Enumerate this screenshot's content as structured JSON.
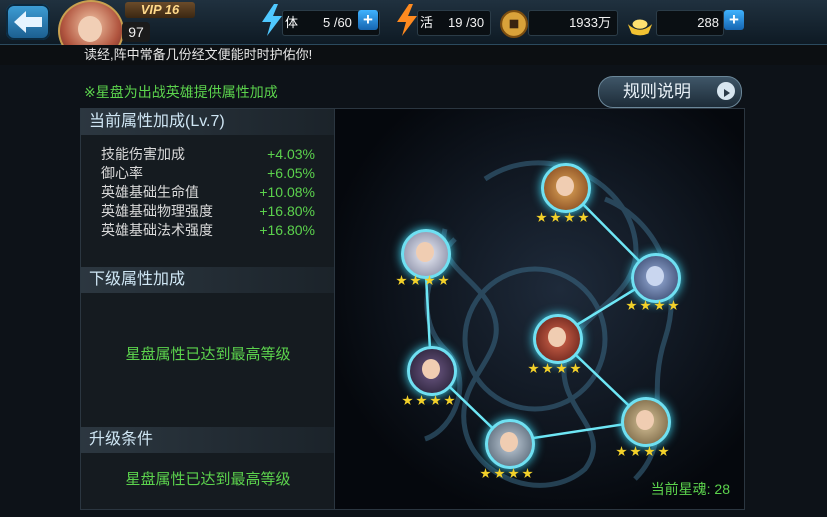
{
  "topbar": {
    "vip": "VIP 16",
    "level": "97",
    "stamina": {
      "label": "体",
      "value": "5 /60"
    },
    "vitality": {
      "label": "活",
      "value": "19 /30"
    },
    "coins": {
      "value": "1933万"
    },
    "gold": {
      "value": "288"
    }
  },
  "ticker": {
    "text": "读经,阵中常备几份经文便能时时护佑你!"
  },
  "note": "※星盘为出战英雄提供属性加成",
  "rules_button": "规则说明",
  "current": {
    "title": "当前属性加成(Lv.7)",
    "attributes": [
      {
        "name": "技能伤害加成",
        "value": "+4.03%"
      },
      {
        "name": "御心率",
        "value": "+6.05%"
      },
      {
        "name": "英雄基础生命值",
        "value": "+10.08%"
      },
      {
        "name": "英雄基础物理强度",
        "value": "+16.80%"
      },
      {
        "name": "英雄基础法术强度",
        "value": "+16.80%"
      }
    ]
  },
  "next": {
    "title": "下级属性加成",
    "message": "星盘属性已达到最高等级"
  },
  "upgrade": {
    "title": "升级条件",
    "message": "星盘属性已达到最高等级"
  },
  "star_souls": "当前星魂: 28",
  "hero_nodes": [
    {
      "name": "hero-top",
      "stars": 4,
      "color": "#c9843a"
    },
    {
      "name": "hero-upper-left",
      "stars": 4,
      "color": "#d7dbe8"
    },
    {
      "name": "hero-upper-right",
      "stars": 4,
      "color": "#6a86b7"
    },
    {
      "name": "hero-center",
      "stars": 4,
      "color": "#b44a3a"
    },
    {
      "name": "hero-left",
      "stars": 4,
      "color": "#4b3b5f"
    },
    {
      "name": "hero-right",
      "stars": 4,
      "color": "#b9a27a"
    },
    {
      "name": "hero-bottom",
      "stars": 4,
      "color": "#9aa9b8"
    }
  ]
}
